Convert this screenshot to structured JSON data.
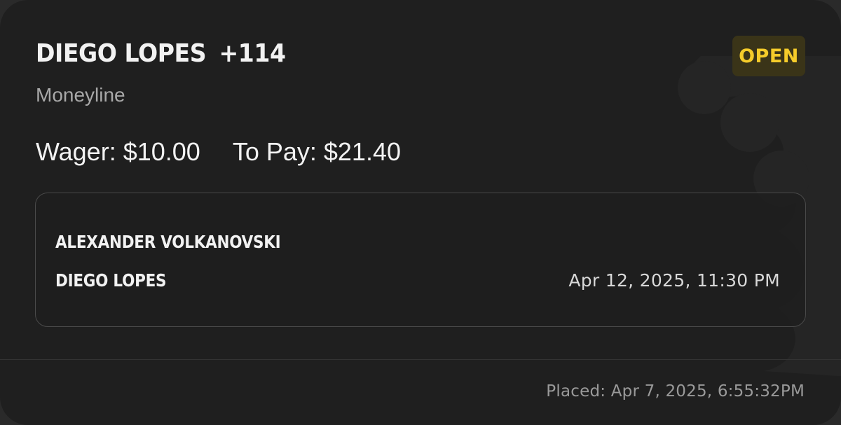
{
  "bet": {
    "selection": "DIEGO LOPES",
    "odds": "+114",
    "type": "Moneyline",
    "status": "OPEN",
    "wager_label": "Wager: $10.00",
    "to_pay_label": "To Pay: $21.40"
  },
  "event": {
    "fighter_1": "ALEXANDER VOLKANOVSKI",
    "fighter_2": "DIEGO LOPES",
    "datetime": "Apr 12, 2025, 11:30 PM"
  },
  "footer": {
    "placed": "Placed: Apr 7, 2025, 6:55:32PM"
  },
  "colors": {
    "background": "#1f1f1f",
    "status_text": "#f5cc2a",
    "status_bg": "#3a3418"
  },
  "icons": {
    "watermark": "brand-logo-watermark"
  }
}
